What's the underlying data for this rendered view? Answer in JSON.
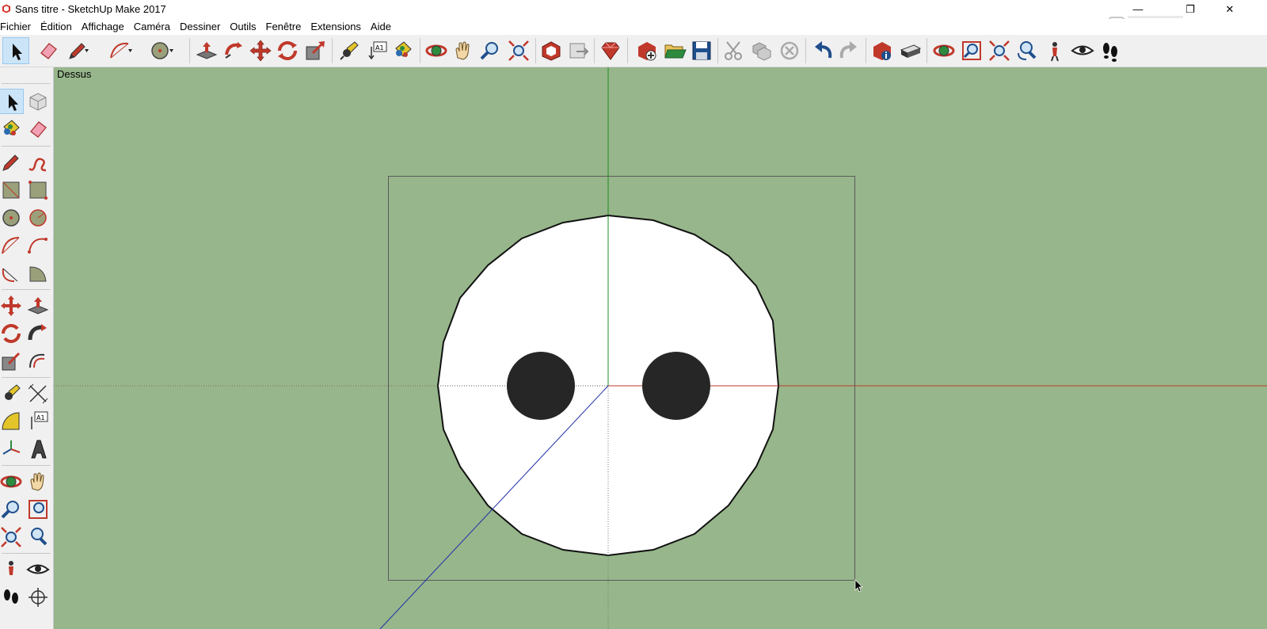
{
  "window": {
    "title": "Sans titre - SketchUp Make 2017",
    "controls": {
      "minimize": "—",
      "restore": "❐",
      "close": "✕"
    }
  },
  "menu": [
    "Fichier",
    "Édition",
    "Affichage",
    "Caméra",
    "Dessiner",
    "Outils",
    "Fenêtre",
    "Extensions",
    "Aide"
  ],
  "viewport": {
    "view_name": "Dessus",
    "background": "#97b68b"
  },
  "colors": {
    "axis_red": "#c0392b",
    "axis_green": "#1e8f1e",
    "axis_blue": "#1f2fa8",
    "face": "#ffffff",
    "holes": "#262626"
  }
}
